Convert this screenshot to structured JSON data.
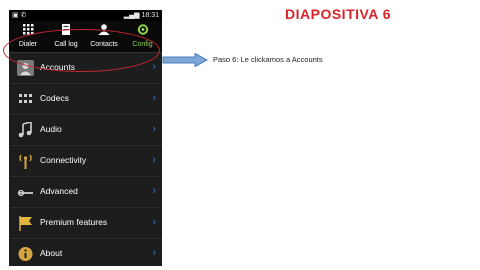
{
  "slide_title": "DIAPOSITIVA 6",
  "caption": "Paso 6: Le clickamos a Accounts",
  "status_bar": {
    "time": "18:31"
  },
  "tabs": [
    {
      "label": "Dialer",
      "icon": "dialpad-icon"
    },
    {
      "label": "Call log",
      "icon": "call-log-icon"
    },
    {
      "label": "Contacts",
      "icon": "contacts-icon"
    },
    {
      "label": "Config",
      "icon": "config-icon",
      "active": true
    }
  ],
  "menu": [
    {
      "label": "Accounts",
      "icon": "accounts-icon"
    },
    {
      "label": "Codecs",
      "icon": "codecs-icon"
    },
    {
      "label": "Audio",
      "icon": "audio-icon"
    },
    {
      "label": "Connectivity",
      "icon": "connectivity-icon"
    },
    {
      "label": "Advanced",
      "icon": "advanced-icon"
    },
    {
      "label": "Premium features",
      "icon": "premium-features-icon"
    },
    {
      "label": "About",
      "icon": "about-icon"
    }
  ],
  "colors": {
    "title": "#d8242b",
    "active_tab": "#8cd24a",
    "highlight_circle": "#c0282f",
    "arrow": "#4a7fc1"
  }
}
